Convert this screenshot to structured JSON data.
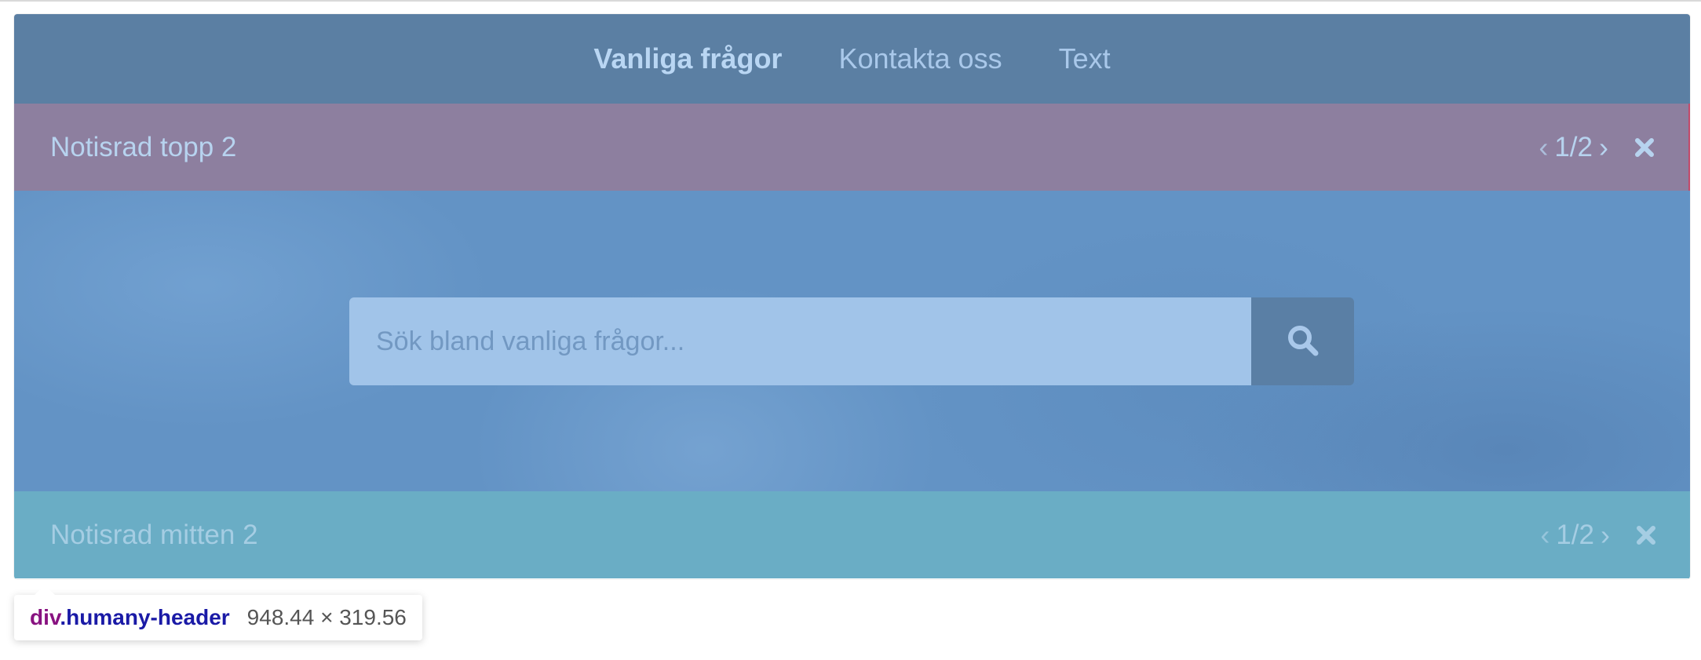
{
  "nav": {
    "items": [
      {
        "label": "Vanliga frågor",
        "active": true
      },
      {
        "label": "Kontakta oss",
        "active": false
      },
      {
        "label": "Text",
        "active": false
      }
    ]
  },
  "notice_top": {
    "message": "Notisrad topp 2",
    "pager": "1/2",
    "prev_icon": "chevron-left-icon",
    "next_icon": "chevron-right-icon",
    "close_icon": "close-icon"
  },
  "search": {
    "placeholder": "Sök bland vanliga frågor...",
    "value": "",
    "button_icon": "search-icon"
  },
  "notice_mid": {
    "message": "Notisrad mitten 2",
    "pager": "1/2",
    "prev_icon": "chevron-left-icon",
    "next_icon": "chevron-right-icon",
    "close_icon": "close-icon"
  },
  "inspector_tooltip": {
    "tag": "div",
    "class": ".humany-header",
    "dimensions": "948.44 × 319.56"
  },
  "colors": {
    "nav_bg": "#5b7fa3",
    "notice_top_bg": "#8d7f9f",
    "hero_bg": "#6393c5",
    "search_input_bg": "#a1c4e9",
    "search_button_bg": "#5a7fa5",
    "notice_mid_bg": "#6aadc5"
  }
}
